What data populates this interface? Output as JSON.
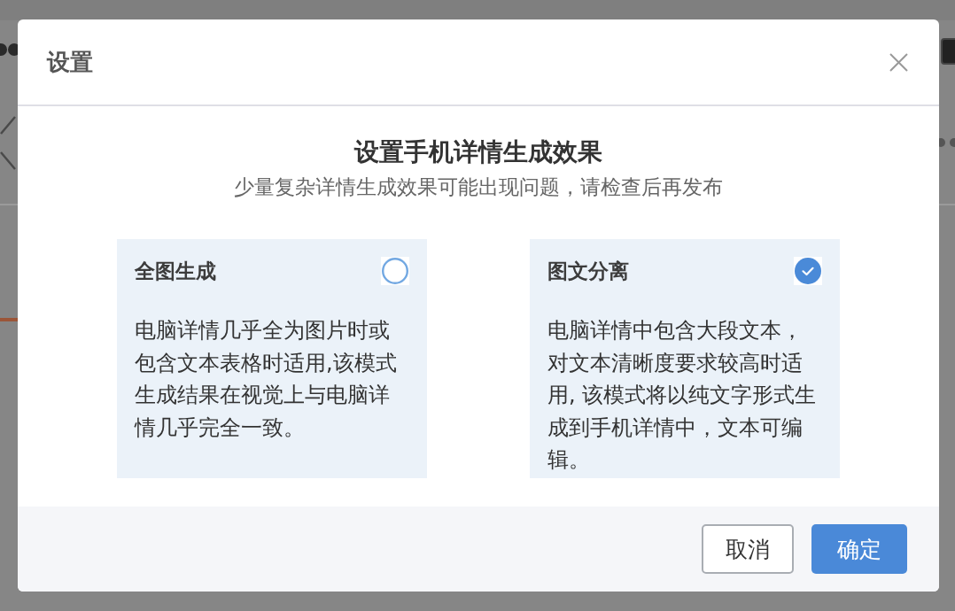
{
  "dialog": {
    "title": "设置",
    "heading": "设置手机详情生成效果",
    "subtitle": "少量复杂详情生成效果可能出现问题，请检查后再发布",
    "options": [
      {
        "title": "全图生成",
        "description": "电脑详情几乎全为图片时或包含文本表格时适用,该模式生成结果在视觉上与电脑详情几乎完全一致。",
        "selected": false
      },
      {
        "title": "图文分离",
        "description": "电脑详情中包含大段文本，对文本清晰度要求较高时适用, 该模式将以纯文字形式生成到手机详情中，文本可编辑。",
        "selected": true
      }
    ],
    "buttons": [
      {
        "label": "取消",
        "kind": "secondary"
      },
      {
        "label": "确定",
        "kind": "primary"
      }
    ]
  }
}
